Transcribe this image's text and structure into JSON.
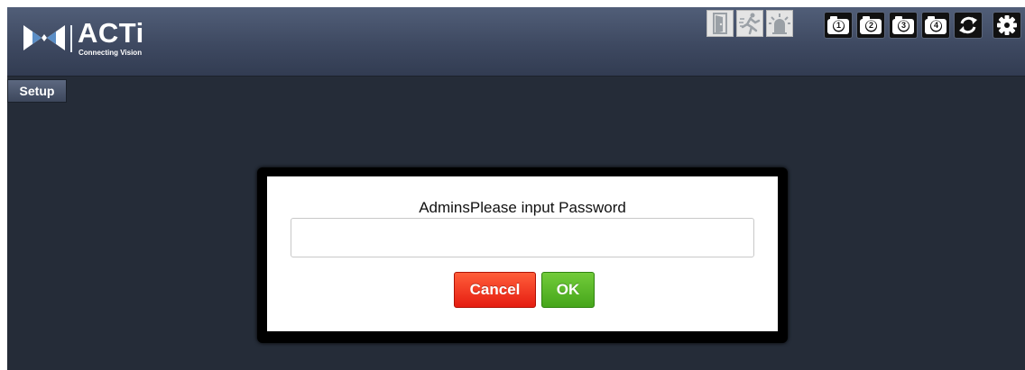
{
  "brand": {
    "name": "ACTi",
    "tagline": "Connecting Vision",
    "icon": "acti-logo-mark"
  },
  "toolbar": {
    "tools": [
      {
        "name": "door-icon"
      },
      {
        "name": "running-person-icon"
      },
      {
        "name": "alarm-light-icon"
      }
    ],
    "cameras": [
      {
        "label": "1",
        "icon": "camera-icon"
      },
      {
        "label": "2",
        "icon": "camera-icon"
      },
      {
        "label": "3",
        "icon": "camera-icon"
      },
      {
        "label": "4",
        "icon": "camera-icon"
      }
    ],
    "refresh_icon": "refresh-icon",
    "settings_icon": "gear-icon"
  },
  "nav": {
    "setup_label": "Setup"
  },
  "dialog": {
    "title": "AdminsPlease input Password",
    "password_value": "",
    "password_placeholder": "",
    "cancel_label": "Cancel",
    "ok_label": "OK"
  },
  "colors": {
    "header_bg": "#3e4961",
    "page_bg": "#252c38",
    "cancel_button": "#e51d11",
    "ok_button": "#46a61b"
  }
}
